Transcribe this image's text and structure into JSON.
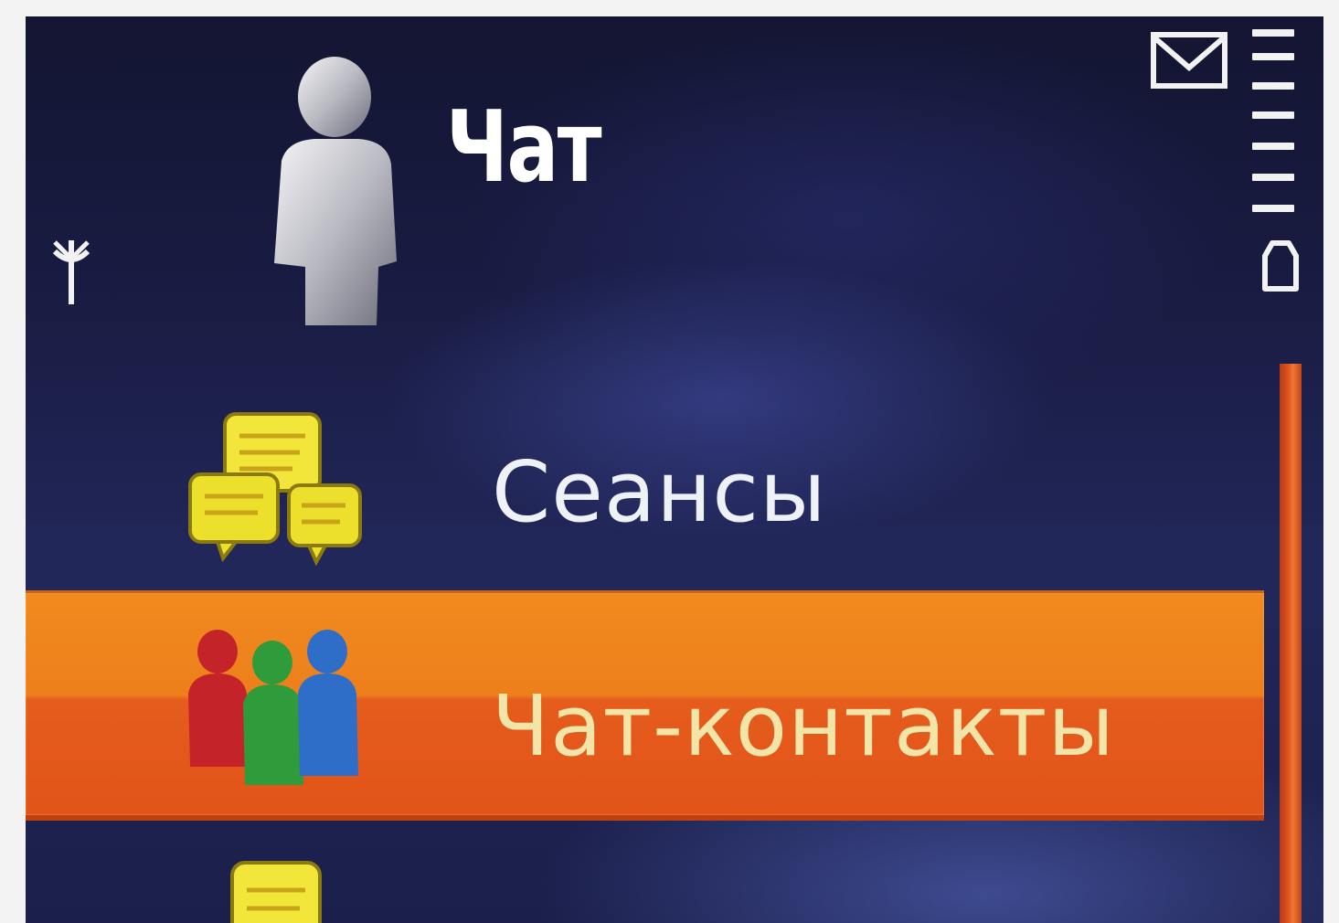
{
  "app": {
    "title": "Чат"
  },
  "menu": {
    "items": [
      {
        "label": "Сеансы",
        "icon": "chat-sessions-icon",
        "selected": false
      },
      {
        "label": "Чат-контакты",
        "icon": "chat-contacts-icon",
        "selected": true
      },
      {
        "label": "",
        "icon": "chat-rooms-icon",
        "selected": false
      }
    ]
  },
  "status": {
    "signal_icon": "antenna-icon",
    "message_icon": "envelope-icon",
    "battery_icon": "battery-icon"
  },
  "colors": {
    "background": "#1a1d45",
    "highlight": "#ee7f1c",
    "highlight_text": "#f3e4a8",
    "text": "#ffffff",
    "scrollbar": "#e45a23"
  },
  "scroll": {
    "position_fraction": 0.0,
    "visible_fraction": 1.0
  }
}
